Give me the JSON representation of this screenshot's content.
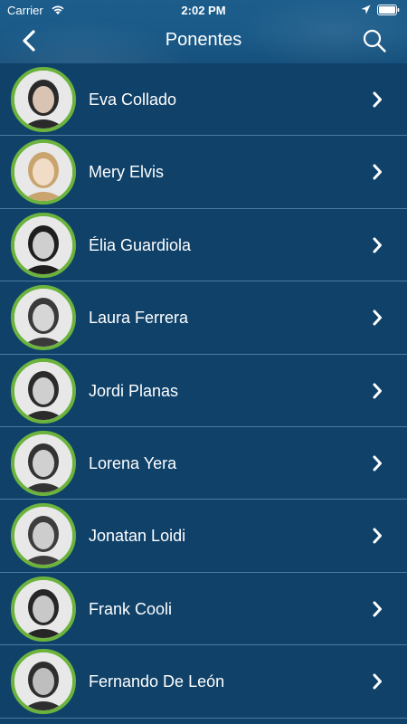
{
  "status_bar": {
    "carrier": "Carrier",
    "time": "2:02 PM"
  },
  "nav": {
    "title": "Ponentes",
    "back_icon": "chevron-left-icon",
    "search_icon": "search-icon"
  },
  "colors": {
    "background": "#0f4169",
    "header": "#1a5a88",
    "avatar_ring": "#6cb33e",
    "divider": "#4d7aa0"
  },
  "speakers": [
    {
      "name": "Eva Collado"
    },
    {
      "name": "Mery Elvis"
    },
    {
      "name": "Élia Guardiola"
    },
    {
      "name": "Laura Ferrera"
    },
    {
      "name": "Jordi Planas"
    },
    {
      "name": "Lorena Yera"
    },
    {
      "name": "Jonatan Loidi"
    },
    {
      "name": "Frank Cooli"
    },
    {
      "name": "Fernando De León"
    }
  ]
}
